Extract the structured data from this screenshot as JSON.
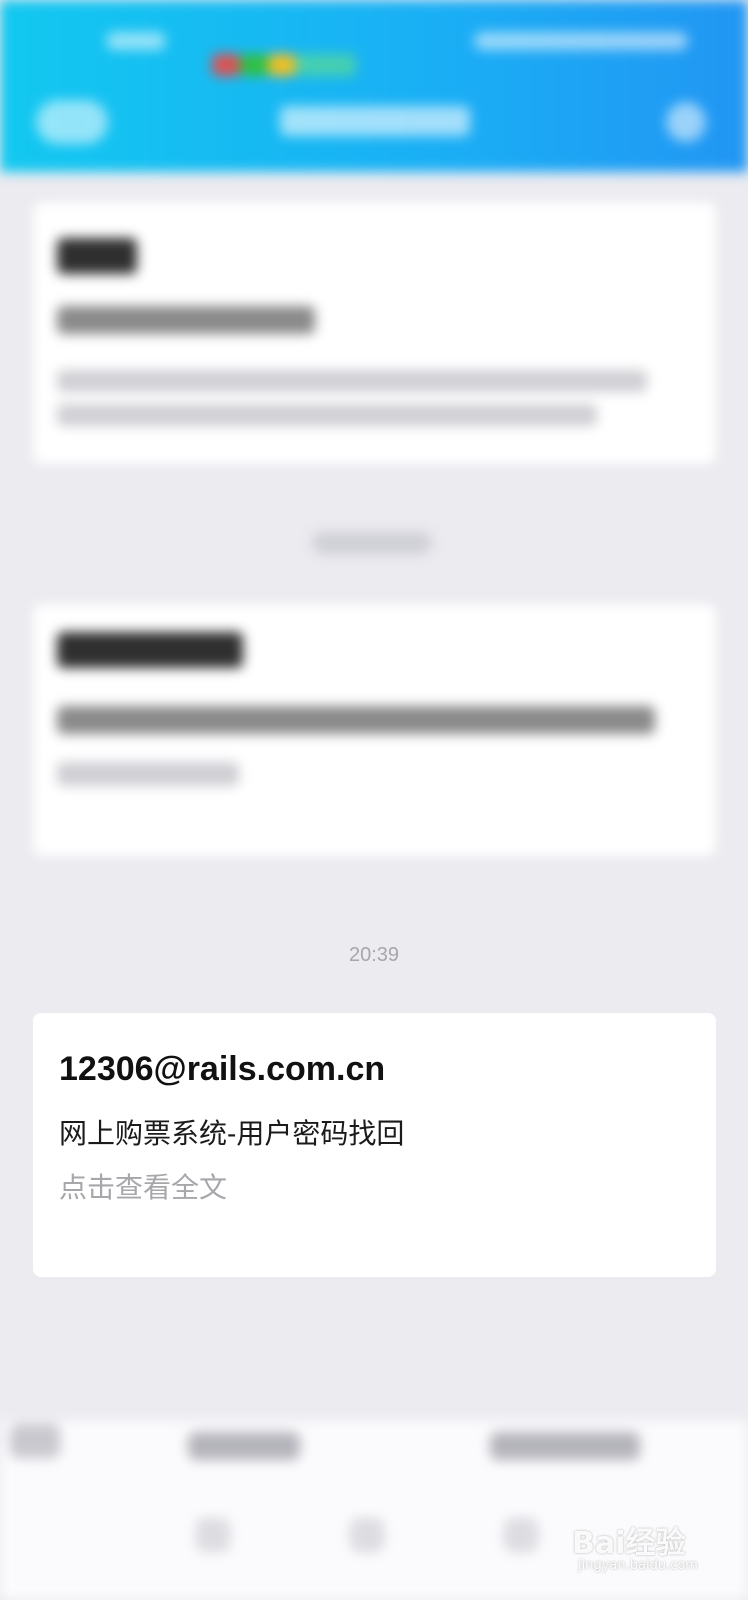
{
  "message": {
    "time": "20:39",
    "sender": "12306@rails.com.cn",
    "subject": "网上购票系统-用户密码找回",
    "read_more": "点击查看全文"
  },
  "watermark": {
    "brand": "Bai经验",
    "domain": "jingyan.baidu.com"
  },
  "colors": {
    "header_start": "#12c8f0",
    "header_end": "#2196f3",
    "background": "#ebebf0",
    "timestamp": "#a6a6ab",
    "read_more": "#a7a7ab"
  },
  "icons": [
    "back-icon",
    "more-icon",
    "keyboard-icon",
    "paw-icon"
  ]
}
